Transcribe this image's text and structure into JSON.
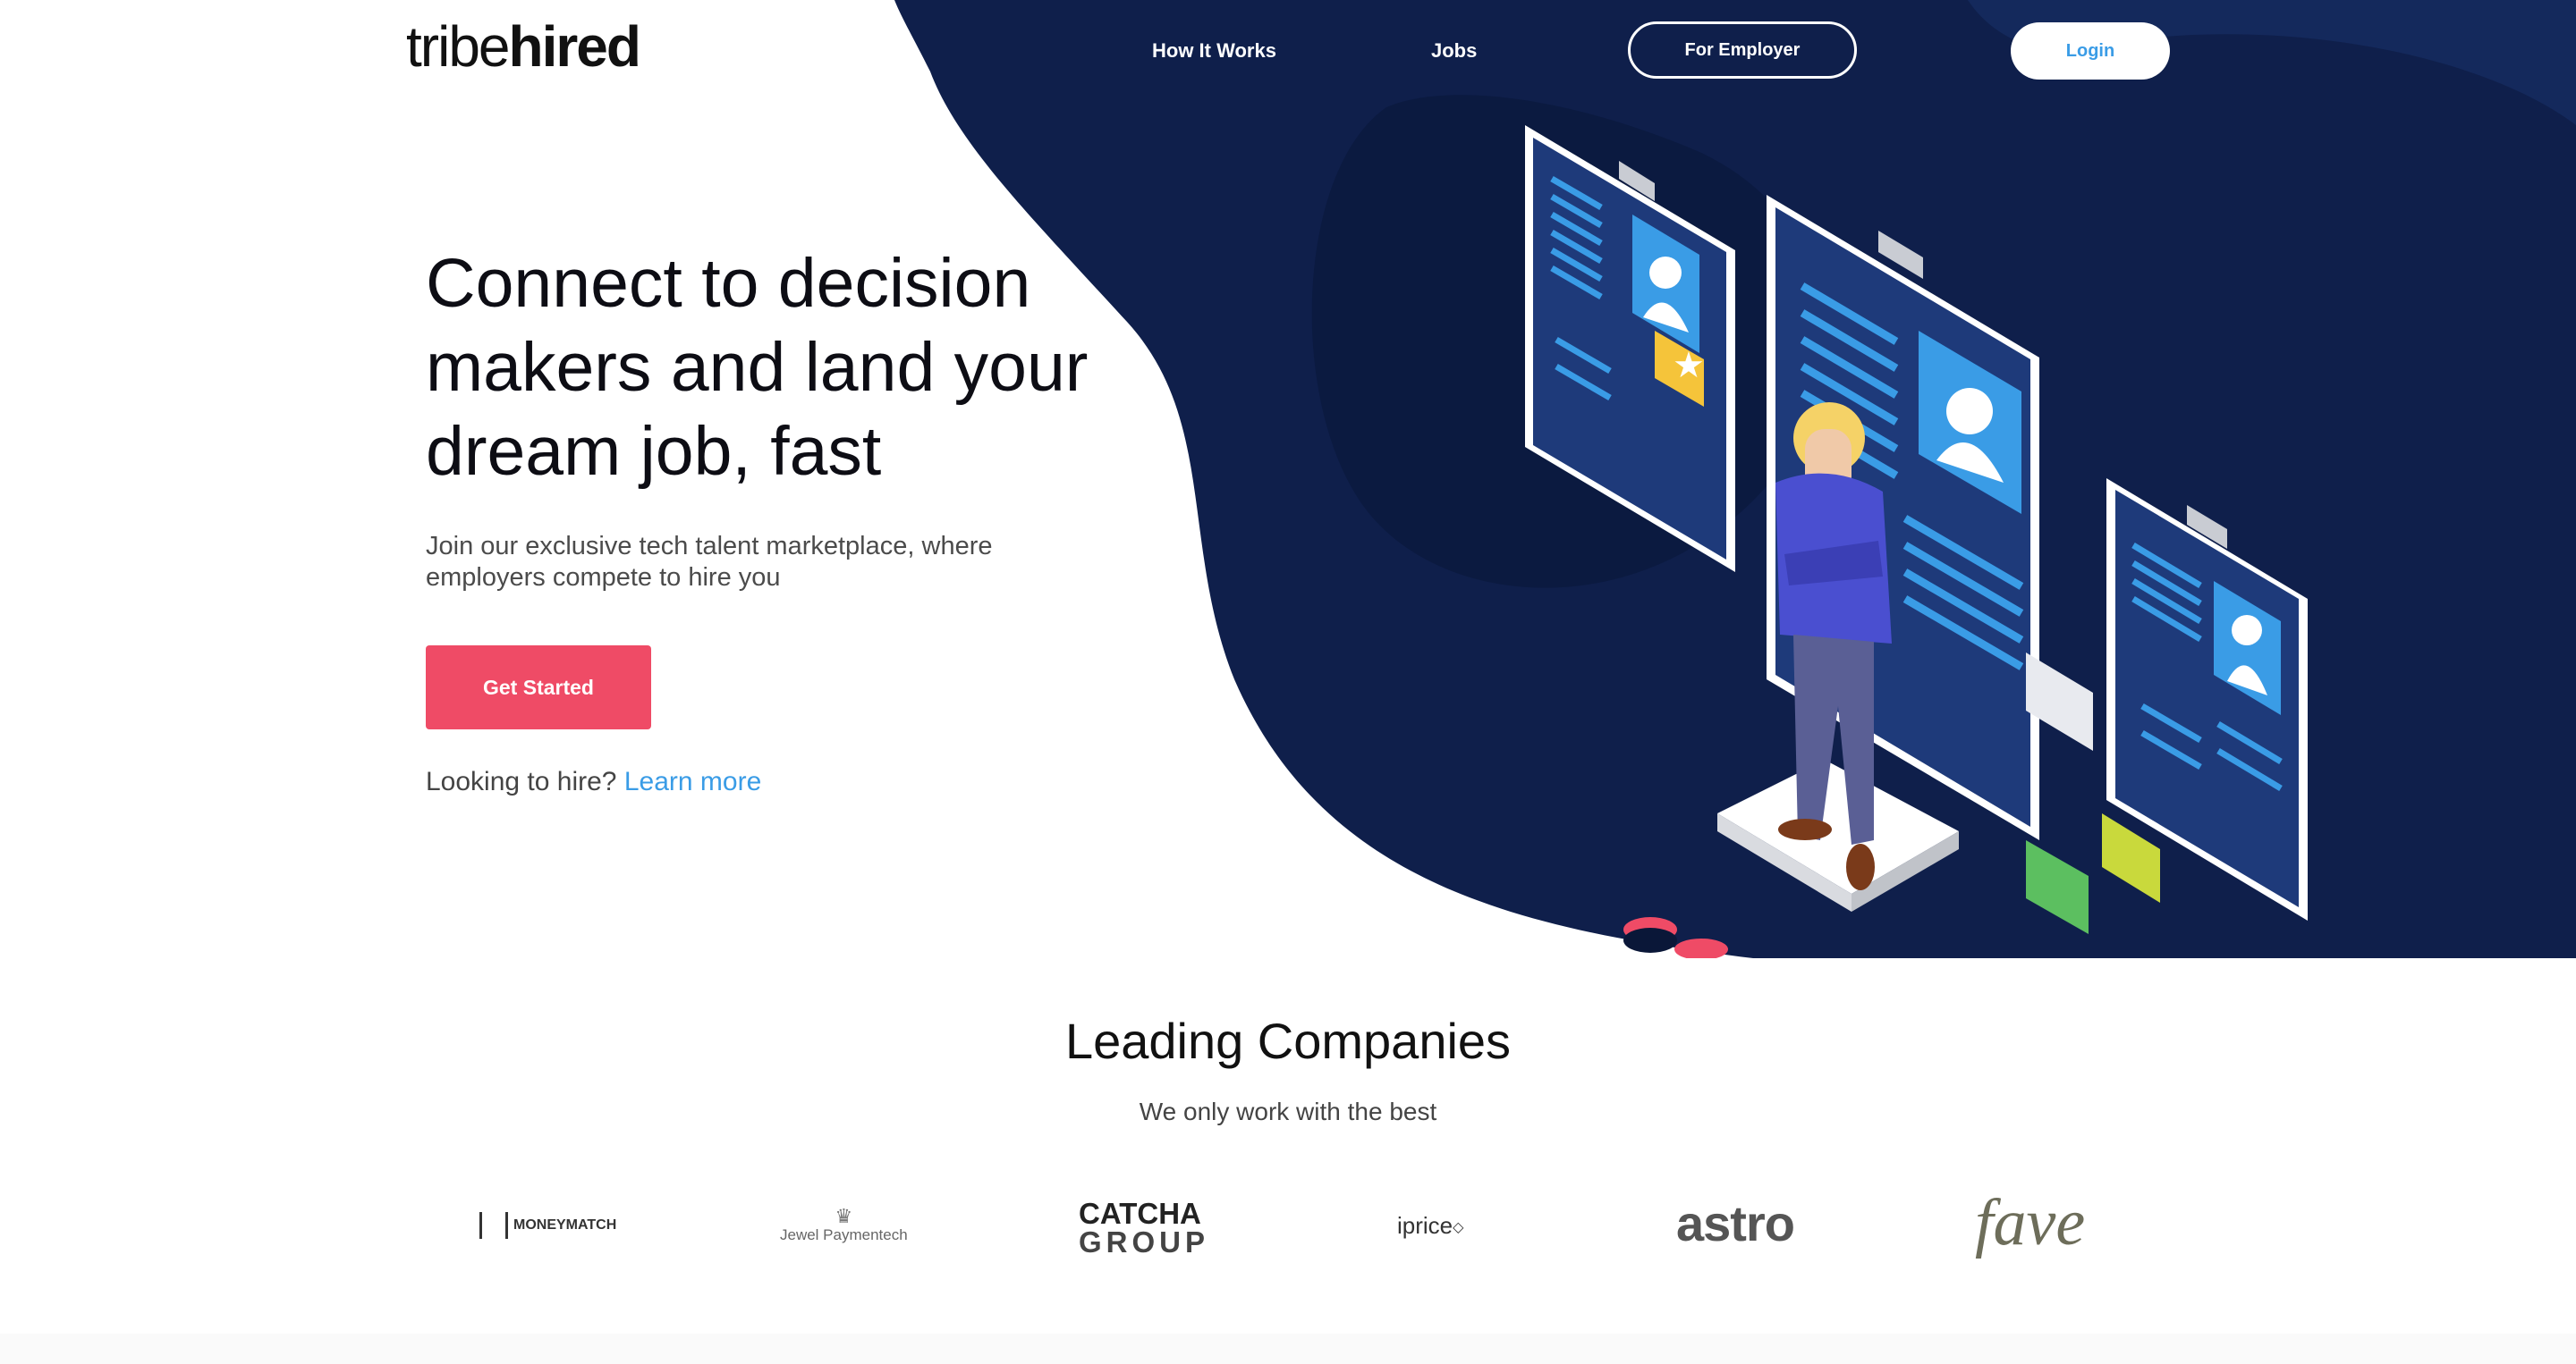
{
  "brand": {
    "logo_light": "tribe",
    "logo_bold": "hired"
  },
  "nav": {
    "how_it_works": "How It Works",
    "jobs": "Jobs",
    "for_employer": "For Employer",
    "login": "Login"
  },
  "hero": {
    "title_line1": "Connect to decision",
    "title_line2": "makers and land your",
    "title_line3": "dream job, fast",
    "subtitle_line1": "Join our exclusive tech talent marketplace, where",
    "subtitle_line2": "employers compete to hire you",
    "cta_label": "Get Started",
    "hire_prompt": "Looking to hire?",
    "hire_link": "Learn more"
  },
  "companies": {
    "title": "Leading Companies",
    "subtitle": "We only work with the best",
    "logos": [
      {
        "name": "MONEYMATCH"
      },
      {
        "name": "Jewel Paymentech"
      },
      {
        "name": "CATCHA",
        "name2": "GROUP"
      },
      {
        "name": "iprice"
      },
      {
        "name": "astro"
      },
      {
        "name": "fave"
      }
    ]
  },
  "colors": {
    "navy": "#0f1f4b",
    "navy_dark": "#0a1738",
    "cta": "#ef4b66",
    "link": "#3a9ce6"
  }
}
